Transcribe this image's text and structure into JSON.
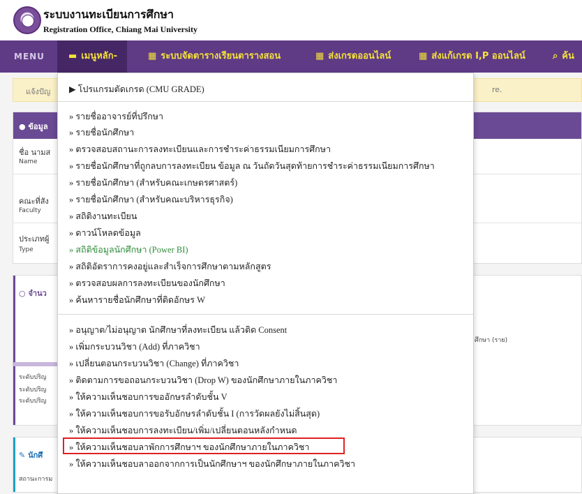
{
  "header": {
    "title_th": "ระบบงานทะเบียนการศึกษา",
    "title_en": "Registration Office, Chiang Mai University"
  },
  "navbar": {
    "menu_label": "MENU",
    "items": [
      {
        "label": "เมนูหลัก-",
        "icon": "folder-open-icon"
      },
      {
        "label": "ระบบจัดตารางเรียนตารางสอน",
        "icon": "calendar-icon"
      },
      {
        "label": "ส่งเกรดออนไลน์",
        "icon": "calendar-icon"
      },
      {
        "label": "ส่งแก้เกรด I,P ออนไลน์",
        "icon": "calendar-icon"
      },
      {
        "label": "ค้น",
        "icon": "search-icon"
      }
    ],
    "colors": {
      "bg": "#5f3b86",
      "text": "#f5e13a"
    }
  },
  "notice": {
    "left_text": "แจ้งปัญ",
    "right_text": "re."
  },
  "panel1": {
    "header": "ข้อมูล",
    "rows": [
      {
        "label": "ชื่อ นามส",
        "sub": "Name"
      },
      {
        "label": "คณะที่สัง",
        "sub": "Faculty"
      },
      {
        "label": "ประเภทผู้",
        "sub": "Type"
      }
    ]
  },
  "panel2": {
    "header": "จำนว",
    "levels": [
      "ระดับปริญ",
      "ระดับปริญ",
      "ระดับปริญ"
    ],
    "right_note": "ศึกษา (ราย)"
  },
  "panel3": {
    "header": "นักศึ",
    "sub": "สถานะการม"
  },
  "dropdown": {
    "top_item": "▶ โปรแกรมตัดเกรด (CMU GRADE)",
    "group1": [
      "» รายชื่ออาจารย์ที่ปรึกษา",
      "» รายชื่อนักศึกษา",
      "» ตรวจสอบสถานะการลงทะเบียนและการชำระค่าธรรมเนียมการศึกษา",
      "» รายชื่อนักศึกษาที่ถูกลบการลงทะเบียน ข้อมูล ณ วันถัดวันสุดท้ายการชำระค่าธรรมเนียมการศึกษา",
      "» รายชื่อนักศึกษา (สำหรับคณะเกษตรศาสตร์)",
      "» รายชื่อนักศึกษา (สำหรับคณะบริหารธุรกิจ)",
      "» สถิติงานทะเบียน",
      "» ดาวน์โหลดข้อมูล",
      "» สถิติข้อมูลนักศึกษา (Power BI)",
      "» สถิติอัตราการคงอยู่และสำเร็จการศึกษาตามหลักสูตร",
      "» ตรวจสอบผลการลงทะเบียนของนักศึกษา",
      "» ค้นหารายชื่อนักศึกษาที่ติดอักษร W"
    ],
    "group2": [
      "» อนุญาต/ไม่อนุญาต นักศึกษาที่ลงทะเบียน แล้วติด Consent",
      "» เพิ่มกระบวนวิชา (Add) ที่ภาควิชา",
      "» เปลี่ยนตอนกระบวนวิชา (Change) ที่ภาควิชา",
      "» ติดตามการขอถอนกระบวนวิชา (Drop W) ของนักศึกษาภายในภาควิชา",
      "» ให้ความเห็นชอบการขออักษรลำดับชั้น V",
      "» ให้ความเห็นชอบการขอรับอักษรลำดับชั้น I (การวัดผลยังไม่สิ้นสุด)",
      "» ให้ความเห็นชอบการลงทะเบียน/เพิ่ม/เปลี่ยนตอนหลังกำหนด",
      "» ให้ความเห็นชอบลาพักการศึกษาฯ ของนักศึกษาภายในภาควิชา",
      "» ให้ความเห็นชอบลาออกจากการเป็นนักศึกษาฯ ของนักศึกษาภายในภาควิชา"
    ],
    "colors": {
      "highlight": "#e02020",
      "green_item": "#2e8b3a"
    }
  }
}
